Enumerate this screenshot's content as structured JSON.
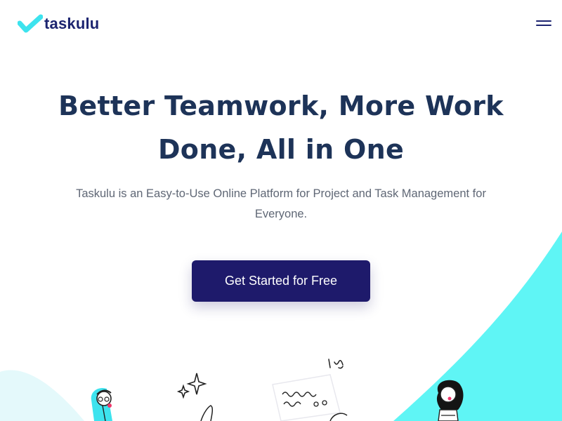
{
  "brand": {
    "name": "taskulu",
    "logo_icon": "check-mark-icon",
    "color": "#1c2470",
    "accent": "#3de3ee"
  },
  "nav": {
    "menu_icon": "hamburger-menu-icon"
  },
  "hero": {
    "title_line1": "Better Teamwork, More Work",
    "title_line2": "Done, All in One",
    "subtitle_line1": "Taskulu is an Easy-to-Use Online Platform for Project and Task Management for",
    "subtitle_line2": "Everyone.",
    "cta_label": "Get Started for Free",
    "cta_color": "#1e1a6b",
    "title_color": "#1d3358"
  },
  "illustration": {
    "name": "team-illustration",
    "wave_color": "#5ff5f5"
  }
}
